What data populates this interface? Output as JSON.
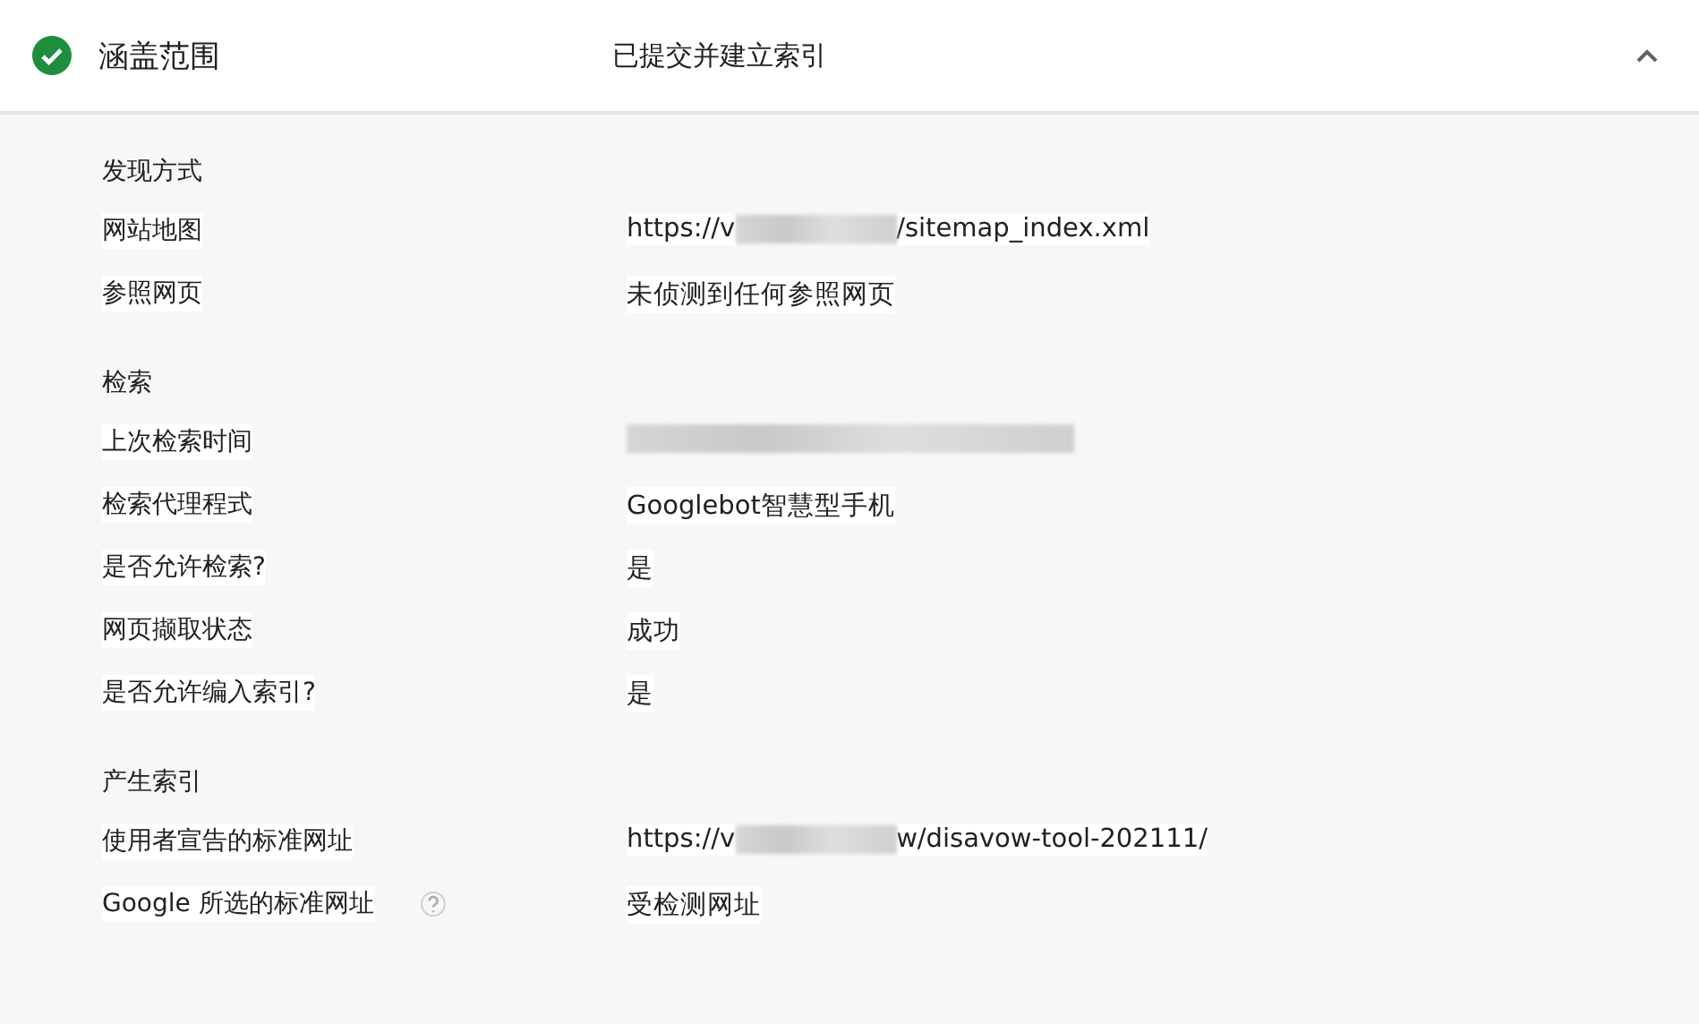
{
  "header": {
    "title": "涵盖范围",
    "status": "已提交并建立索引",
    "expanded": true
  },
  "sections": [
    {
      "title": "发现方式",
      "rows": [
        {
          "label": "网站地图",
          "value": [
            {
              "kind": "text",
              "text": "https://v"
            },
            {
              "kind": "redacted"
            },
            {
              "kind": "text",
              "text": "/sitemap_index.xml"
            }
          ]
        },
        {
          "label": "参照网页",
          "value": [
            {
              "kind": "text",
              "text": "未侦测到任何参照网页"
            }
          ]
        }
      ]
    },
    {
      "title": "检索",
      "rows": [
        {
          "label": "上次检索时间",
          "value": [
            {
              "kind": "redacted"
            }
          ]
        },
        {
          "label": "检索代理程式",
          "value": [
            {
              "kind": "text",
              "text": "Googlebot智慧型手机"
            }
          ]
        },
        {
          "label": "是否允许检索?",
          "value": [
            {
              "kind": "text",
              "text": "是"
            }
          ]
        },
        {
          "label": "网页撷取状态",
          "value": [
            {
              "kind": "text",
              "text": "成功"
            }
          ]
        },
        {
          "label": "是否允许编入索引?",
          "value": [
            {
              "kind": "text",
              "text": "是"
            }
          ]
        }
      ]
    },
    {
      "title": "产生索引",
      "rows": [
        {
          "label": "使用者宣告的标准网址",
          "value": [
            {
              "kind": "text",
              "text": "https://v"
            },
            {
              "kind": "redacted"
            },
            {
              "kind": "text",
              "text": "w/disavow-tool-202111/"
            }
          ]
        },
        {
          "label": "Google 所选的标准网址",
          "help": true,
          "value": [
            {
              "kind": "text",
              "text": "受检测网址"
            }
          ]
        }
      ]
    }
  ]
}
